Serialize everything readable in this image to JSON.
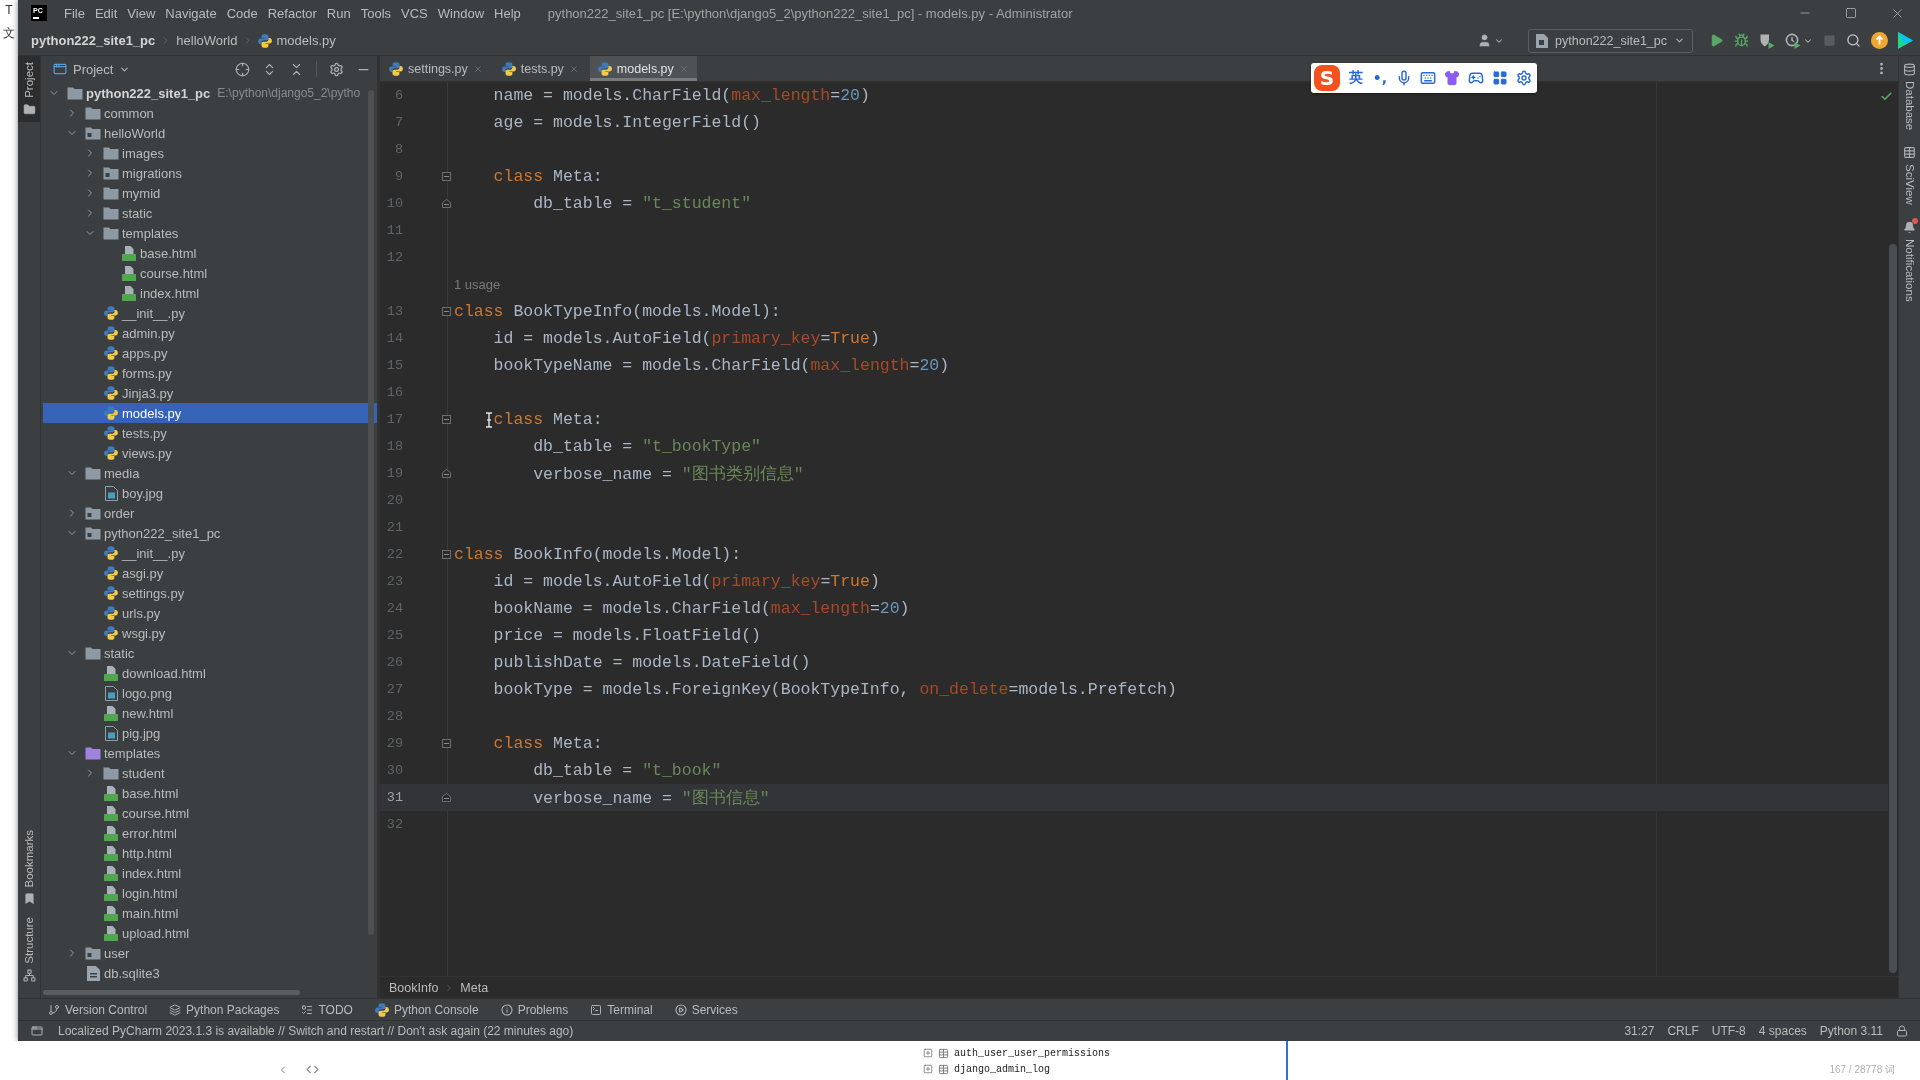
{
  "desktop": {
    "glyphs": [
      "T",
      "文"
    ]
  },
  "window": {
    "logo": "PC",
    "title": "python222_site1_pc [E:\\python\\django5_2\\python222_site1_pc] - models.py - Administrator",
    "menu": [
      "File",
      "Edit",
      "View",
      "Navigate",
      "Code",
      "Refactor",
      "Run",
      "Tools",
      "VCS",
      "Window",
      "Help"
    ]
  },
  "navigation_bar": {
    "breadcrumbs": [
      {
        "label": "python222_site1_pc",
        "kind": "project"
      },
      {
        "label": "helloWorld",
        "kind": "folder"
      },
      {
        "label": "models.py",
        "kind": "python"
      }
    ],
    "run_configuration": "python222_site1_pc"
  },
  "left_tool_strip": [
    {
      "label": "Project",
      "kind": "project",
      "selected": true
    },
    {
      "label": "Bookmarks",
      "kind": "bookmarks",
      "selected": false
    },
    {
      "label": "Structure",
      "kind": "structure",
      "selected": false
    }
  ],
  "project_panel": {
    "title": "Project",
    "tree": [
      {
        "label": "python222_site1_pc",
        "path": "E:\\python\\django5_2\\pytho",
        "kind": "folder",
        "expanded": true,
        "selected": false,
        "children": [
          {
            "label": "common",
            "kind": "folder",
            "expanded": false,
            "selected": false
          },
          {
            "label": "helloWorld",
            "kind": "package",
            "expanded": true,
            "selected": false,
            "children": [
              {
                "label": "images",
                "kind": "folder",
                "expanded": false,
                "selected": false
              },
              {
                "label": "migrations",
                "kind": "package",
                "expanded": false,
                "selected": false
              },
              {
                "label": "mymid",
                "kind": "folder",
                "expanded": false,
                "selected": false
              },
              {
                "label": "static",
                "kind": "folder",
                "expanded": false,
                "selected": false
              },
              {
                "label": "templates",
                "kind": "folder",
                "expanded": true,
                "selected": false,
                "children": [
                  {
                    "label": "base.html",
                    "kind": "html",
                    "selected": false
                  },
                  {
                    "label": "course.html",
                    "kind": "html",
                    "selected": false
                  },
                  {
                    "label": "index.html",
                    "kind": "html",
                    "selected": false
                  }
                ]
              },
              {
                "label": "__init__.py",
                "kind": "python",
                "selected": false
              },
              {
                "label": "admin.py",
                "kind": "python",
                "selected": false
              },
              {
                "label": "apps.py",
                "kind": "python",
                "selected": false
              },
              {
                "label": "forms.py",
                "kind": "python",
                "selected": false
              },
              {
                "label": "Jinja3.py",
                "kind": "python",
                "selected": false
              },
              {
                "label": "models.py",
                "kind": "python",
                "selected": true
              },
              {
                "label": "tests.py",
                "kind": "python",
                "selected": false
              },
              {
                "label": "views.py",
                "kind": "python",
                "selected": false
              }
            ]
          },
          {
            "label": "media",
            "kind": "folder",
            "expanded": true,
            "selected": false,
            "children": [
              {
                "label": "boy.jpg",
                "kind": "image",
                "selected": false
              }
            ]
          },
          {
            "label": "order",
            "kind": "package",
            "expanded": false,
            "selected": false
          },
          {
            "label": "python222_site1_pc",
            "kind": "package",
            "expanded": true,
            "selected": false,
            "children": [
              {
                "label": "__init__.py",
                "kind": "python",
                "selected": false
              },
              {
                "label": "asgi.py",
                "kind": "python",
                "selected": false
              },
              {
                "label": "settings.py",
                "kind": "python",
                "selected": false
              },
              {
                "label": "urls.py",
                "kind": "python",
                "selected": false
              },
              {
                "label": "wsgi.py",
                "kind": "python",
                "selected": false
              }
            ]
          },
          {
            "label": "static",
            "kind": "folder",
            "expanded": true,
            "selected": false,
            "children": [
              {
                "label": "download.html",
                "kind": "html",
                "selected": false
              },
              {
                "label": "logo.png",
                "kind": "image",
                "selected": false
              },
              {
                "label": "new.html",
                "kind": "html",
                "selected": false
              },
              {
                "label": "pig.jpg",
                "kind": "image",
                "selected": false
              }
            ]
          },
          {
            "label": "templates",
            "kind": "templates",
            "expanded": true,
            "selected": false,
            "children": [
              {
                "label": "student",
                "kind": "folder",
                "expanded": false,
                "selected": false
              },
              {
                "label": "base.html",
                "kind": "html",
                "selected": false
              },
              {
                "label": "course.html",
                "kind": "html",
                "selected": false
              },
              {
                "label": "error.html",
                "kind": "html",
                "selected": false
              },
              {
                "label": "http.html",
                "kind": "html",
                "selected": false
              },
              {
                "label": "index.html",
                "kind": "html",
                "selected": false
              },
              {
                "label": "login.html",
                "kind": "html",
                "selected": false
              },
              {
                "label": "main.html",
                "kind": "html",
                "selected": false
              },
              {
                "label": "upload.html",
                "kind": "html",
                "selected": false
              }
            ]
          },
          {
            "label": "user",
            "kind": "package",
            "expanded": false,
            "selected": false
          },
          {
            "label": "db.sqlite3",
            "kind": "database",
            "selected": false
          }
        ]
      }
    ]
  },
  "editor": {
    "tabs": [
      {
        "label": "settings.py",
        "selected": false
      },
      {
        "label": "tests.py",
        "selected": false
      },
      {
        "label": "models.py",
        "selected": true
      }
    ],
    "ime_toolbar": {
      "logo": "S",
      "mode": "英",
      "punctuation": "•,"
    },
    "lines": [
      {
        "kind": "code",
        "number": "6",
        "current": false,
        "tokens": [
          {
            "text": "    name = models.CharField(",
            "kind": "plain"
          },
          {
            "text": "max_length",
            "kind": "param"
          },
          {
            "text": "=",
            "kind": "plain"
          },
          {
            "text": "20",
            "kind": "number"
          },
          {
            "text": ")",
            "kind": "plain"
          }
        ]
      },
      {
        "kind": "code",
        "number": "7",
        "current": false,
        "tokens": [
          {
            "text": "    age = models.IntegerField()",
            "kind": "plain"
          }
        ]
      },
      {
        "kind": "code",
        "number": "8",
        "current": false
      },
      {
        "kind": "code",
        "number": "9",
        "current": false,
        "fold": {
          "kind": "start"
        },
        "tokens": [
          {
            "text": "    class",
            "kind": "keyword"
          },
          {
            "text": " Meta:",
            "kind": "plain"
          }
        ]
      },
      {
        "kind": "code",
        "number": "10",
        "current": false,
        "fold": {
          "kind": "end"
        },
        "tokens": [
          {
            "text": "        db_table = ",
            "kind": "plain"
          },
          {
            "text": "\"t_student\"",
            "kind": "string"
          }
        ]
      },
      {
        "kind": "code",
        "number": "11",
        "current": false
      },
      {
        "kind": "code",
        "number": "12",
        "current": false
      },
      {
        "kind": "inlay",
        "text": "1 usage"
      },
      {
        "kind": "code",
        "number": "13",
        "current": false,
        "fold": {
          "kind": "start"
        },
        "tokens": [
          {
            "text": "class",
            "kind": "keyword"
          },
          {
            "text": " BookTypeInfo(models.Model):",
            "kind": "plain"
          }
        ]
      },
      {
        "kind": "code",
        "number": "14",
        "current": false,
        "tokens": [
          {
            "text": "    id = models.AutoField(",
            "kind": "plain"
          },
          {
            "text": "primary_key",
            "kind": "param"
          },
          {
            "text": "=",
            "kind": "plain"
          },
          {
            "text": "True",
            "kind": "keyword"
          },
          {
            "text": ")",
            "kind": "plain"
          }
        ]
      },
      {
        "kind": "code",
        "number": "15",
        "current": false,
        "tokens": [
          {
            "text": "    bookTypeName = models.CharField(",
            "kind": "plain"
          },
          {
            "text": "max_length",
            "kind": "param"
          },
          {
            "text": "=",
            "kind": "plain"
          },
          {
            "text": "20",
            "kind": "number"
          },
          {
            "text": ")",
            "kind": "plain"
          }
        ]
      },
      {
        "kind": "code",
        "number": "16",
        "current": false
      },
      {
        "kind": "code",
        "number": "17",
        "current": false,
        "fold": {
          "kind": "start"
        },
        "tokens": [
          {
            "text": "    class",
            "kind": "keyword"
          },
          {
            "text": " Meta:",
            "kind": "plain"
          }
        ]
      },
      {
        "kind": "code",
        "number": "18",
        "current": false,
        "tokens": [
          {
            "text": "        db_table = ",
            "kind": "plain"
          },
          {
            "text": "\"t_bookType\"",
            "kind": "string"
          }
        ]
      },
      {
        "kind": "code",
        "number": "19",
        "current": false,
        "fold": {
          "kind": "end"
        },
        "tokens": [
          {
            "text": "        verbose_name = ",
            "kind": "plain"
          },
          {
            "text": "\"图书类别信息\"",
            "kind": "string"
          }
        ]
      },
      {
        "kind": "code",
        "number": "20",
        "current": false
      },
      {
        "kind": "code",
        "number": "21",
        "current": false
      },
      {
        "kind": "code",
        "number": "22",
        "current": false,
        "fold": {
          "kind": "start"
        },
        "tokens": [
          {
            "text": "class",
            "kind": "keyword"
          },
          {
            "text": " BookInfo(models.Model):",
            "kind": "plain"
          }
        ]
      },
      {
        "kind": "code",
        "number": "23",
        "current": false,
        "tokens": [
          {
            "text": "    id = models.AutoField(",
            "kind": "plain"
          },
          {
            "text": "primary_key",
            "kind": "param"
          },
          {
            "text": "=",
            "kind": "plain"
          },
          {
            "text": "True",
            "kind": "keyword"
          },
          {
            "text": ")",
            "kind": "plain"
          }
        ]
      },
      {
        "kind": "code",
        "number": "24",
        "current": false,
        "tokens": [
          {
            "text": "    bookName = models.CharField(",
            "kind": "plain"
          },
          {
            "text": "max_length",
            "kind": "param"
          },
          {
            "text": "=",
            "kind": "plain"
          },
          {
            "text": "20",
            "kind": "number"
          },
          {
            "text": ")",
            "kind": "plain"
          }
        ]
      },
      {
        "kind": "code",
        "number": "25",
        "current": false,
        "tokens": [
          {
            "text": "    price = models.FloatField()",
            "kind": "plain"
          }
        ]
      },
      {
        "kind": "code",
        "number": "26",
        "current": false,
        "tokens": [
          {
            "text": "    publishDate = models.DateField()",
            "kind": "plain"
          }
        ]
      },
      {
        "kind": "code",
        "number": "27",
        "current": false,
        "tokens": [
          {
            "text": "    bookType = models.ForeignKey(BookTypeInfo, ",
            "kind": "plain"
          },
          {
            "text": "on_delete",
            "kind": "param"
          },
          {
            "text": "=models.Prefetch)",
            "kind": "plain"
          }
        ]
      },
      {
        "kind": "code",
        "number": "28",
        "current": false
      },
      {
        "kind": "code",
        "number": "29",
        "current": false,
        "fold": {
          "kind": "start"
        },
        "tokens": [
          {
            "text": "    class",
            "kind": "keyword"
          },
          {
            "text": " Meta:",
            "kind": "plain"
          }
        ]
      },
      {
        "kind": "code",
        "number": "30",
        "current": false,
        "tokens": [
          {
            "text": "        db_table = ",
            "kind": "plain"
          },
          {
            "text": "\"t_book\"",
            "kind": "string"
          }
        ]
      },
      {
        "kind": "code",
        "number": "31",
        "current": true,
        "fold": {
          "kind": "end"
        },
        "tokens": [
          {
            "text": "        verbose_name = ",
            "kind": "plain"
          },
          {
            "text": "\"图书信息\"",
            "kind": "string"
          }
        ]
      },
      {
        "kind": "code",
        "number": "32",
        "current": false
      }
    ],
    "breadcrumbs": [
      "BookInfo",
      "Meta"
    ]
  },
  "right_tool_strip": [
    {
      "label": "Database",
      "kind": "database"
    },
    {
      "label": "SciView",
      "kind": "sciview"
    },
    {
      "label": "Notifications",
      "kind": "notifications",
      "unread": true
    }
  ],
  "tool_window_bar": [
    {
      "label": "Version Control",
      "kind": "vcs"
    },
    {
      "label": "Python Packages",
      "kind": "packages"
    },
    {
      "label": "TODO",
      "kind": "todo"
    },
    {
      "label": "Python Console",
      "kind": "console"
    },
    {
      "label": "Problems",
      "kind": "problems"
    },
    {
      "label": "Terminal",
      "kind": "terminal"
    },
    {
      "label": "Services",
      "kind": "services"
    }
  ],
  "status_bar": {
    "message": "Localized PyCharm 2023.1.3 is available // Switch and restart // Don't ask again (22 minutes ago)",
    "widgets": [
      "31:27",
      "CRLF",
      "UTF-8",
      "4 spaces",
      "Python 3.11"
    ]
  },
  "background_window": {
    "tables": [
      "auth_user_user_permissions",
      "django_admin_log"
    ],
    "word_count": "167 / 28778 词"
  }
}
